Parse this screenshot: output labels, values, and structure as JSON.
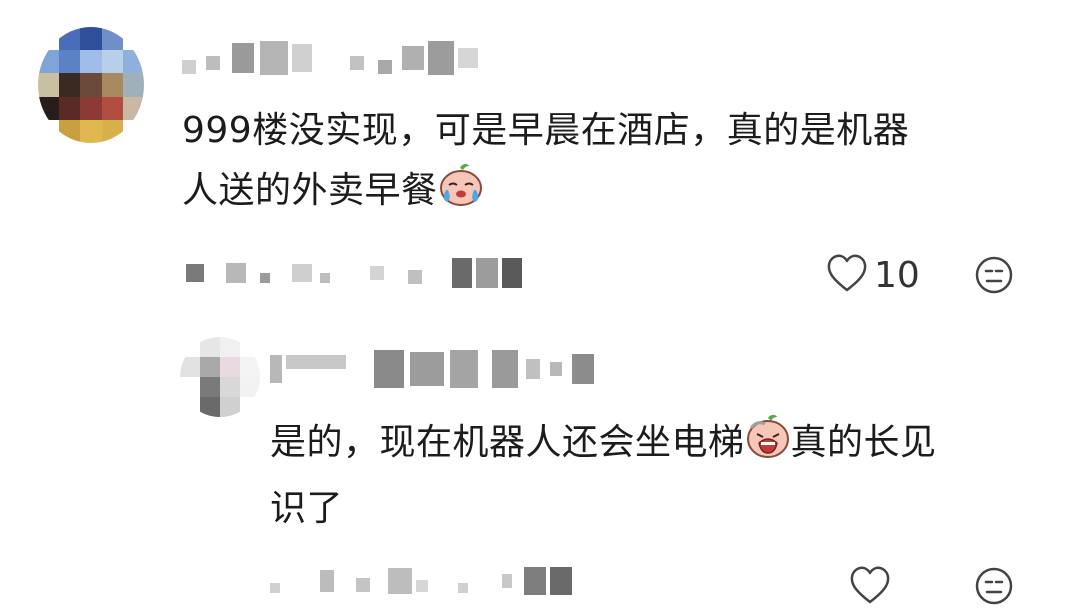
{
  "comments": [
    {
      "text_line1": "999楼没实现，可是早晨在酒店，真的是机器",
      "text_line2": "人送的外卖早餐",
      "emoji": "crying-face-emoji",
      "like_count": "10",
      "icons": {
        "like": "heart-outline-icon",
        "dislike": "neutral-face-icon"
      }
    }
  ],
  "replies": [
    {
      "text_line1_a": "是的，现在机器人还会坐电梯",
      "text_line1_b": "真的长见",
      "text_line2": "识了",
      "emoji": "wailing-face-emoji",
      "like_count": "",
      "icons": {
        "like": "heart-outline-icon",
        "dislike": "neutral-face-icon"
      }
    }
  ],
  "colors": {
    "text": "#1c1c1c",
    "icon": "#444444",
    "blur": "#c8c8c8"
  }
}
